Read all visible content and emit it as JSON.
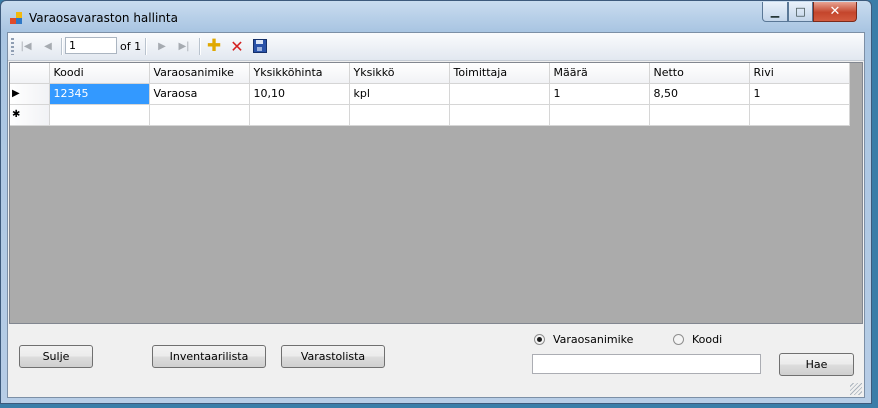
{
  "window": {
    "title": "Varaosavaraston hallinta",
    "caption_buttons": {
      "minimize": "▁",
      "maximize": "□",
      "close": "✕"
    }
  },
  "navigator": {
    "position_value": "1",
    "count_label": "of 1",
    "icons": {
      "first": "first-record-icon",
      "previous": "previous-record-icon",
      "next": "next-record-icon",
      "last": "last-record-icon",
      "add": "add-new-icon",
      "delete": "delete-icon",
      "save": "save-icon"
    }
  },
  "grid": {
    "columns": [
      "Koodi",
      "Varaosanimike",
      "Yksikköhinta",
      "Yksikkö",
      "Toimittaja",
      "Määrä",
      "Netto",
      "Rivi"
    ],
    "rows": [
      {
        "marker": "▶",
        "cells": [
          "12345",
          "Varaosa",
          "10,10",
          "kpl",
          "",
          "1",
          "8,50",
          "1"
        ]
      }
    ],
    "new_row_marker": "✱"
  },
  "buttons": {
    "close": "Sulje",
    "inventory": "Inventaarilista",
    "stock": "Varastolista",
    "search": "Hae"
  },
  "search": {
    "options": [
      "Varaosanimike",
      "Koodi"
    ],
    "selected": "Varaosanimike",
    "value": ""
  },
  "colors": {
    "selection": "#3399ff",
    "grid_background": "#ababab"
  }
}
